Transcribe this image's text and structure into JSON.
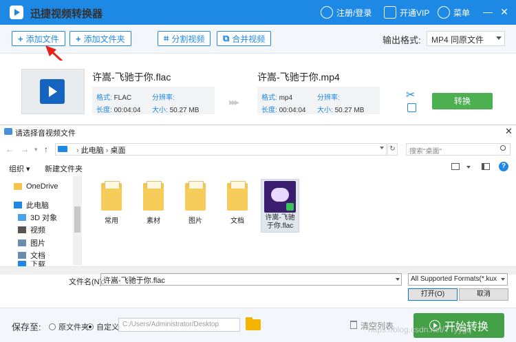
{
  "app": {
    "title": "迅捷视频转换器"
  },
  "titlebar": {
    "login": "注册/登录",
    "vip": "开通VIP",
    "menu": "菜单",
    "minimize": "—",
    "close": "✕"
  },
  "toolbar": {
    "add_file": "添加文件",
    "add_folder": "添加文件夹",
    "split_video": "分割视频",
    "merge_video": "合并视频",
    "output_format_label": "输出格式:",
    "output_format_value": "MP4  同原文件"
  },
  "file_row": {
    "source": {
      "name": "许嵩-飞驰于你.flac",
      "format_k": "格式:",
      "format": "FLAC",
      "resolution_k": "分辨率:",
      "resolution": "",
      "duration_k": "长度:",
      "duration": "00:04:04",
      "size_k": "大小:",
      "size": "50.27 MB"
    },
    "target": {
      "name": "许嵩-飞驰于你.mp4",
      "format_k": "格式:",
      "format": "mp4",
      "resolution_k": "分辨率:",
      "resolution": "",
      "duration_k": "长度:",
      "duration": "00:04:04",
      "size_k": "大小:",
      "size": "50.27 MB"
    },
    "convert_label": "转换"
  },
  "dialog": {
    "title": "请选择音视频文件",
    "path": [
      "此电脑",
      "桌面"
    ],
    "search_placeholder": "搜索\"桌面\"",
    "organize": "组织 ▾",
    "new_folder": "新建文件夹",
    "nav_items": [
      {
        "label": "OneDrive",
        "color": "#f4c44e"
      },
      {
        "label": "此电脑",
        "color": "#1e88e5"
      },
      {
        "label": "3D 对象",
        "color": "#4aa3e8"
      },
      {
        "label": "视频",
        "color": "#555555"
      },
      {
        "label": "图片",
        "color": "#6a8caf"
      },
      {
        "label": "文档",
        "color": "#6a8caf"
      },
      {
        "label": "下载",
        "color": "#1e88e5"
      }
    ],
    "files": [
      {
        "label": "常用"
      },
      {
        "label": "素材"
      },
      {
        "label": "图片"
      },
      {
        "label": "文档"
      }
    ],
    "selected_file": {
      "line1": "许嵩-飞驰",
      "line2": "于你.flac"
    },
    "filename_label": "文件名(N):",
    "filename_value": "许嵩-飞驰于你.flac",
    "filetype_value": "All Supported Formats(*.kux",
    "open": "打开(O)",
    "cancel": "取消"
  },
  "bottom": {
    "save_to": "保存至:",
    "original_folder": "原文件夹",
    "custom": "自定义",
    "path": "C:/Users/Administrator/Desktop",
    "clear_list": "清空列表",
    "start": "开始转换",
    "watermark": "https://blog.csdn.net/TTyygq"
  },
  "colors": {
    "brand": "#1e88e5",
    "go": "#4caf50",
    "annotation": "#e8221b"
  }
}
